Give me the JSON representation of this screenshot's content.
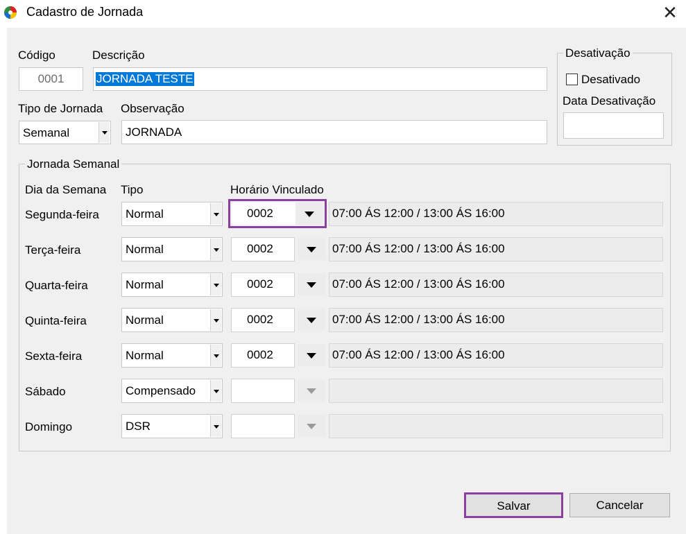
{
  "window": {
    "title": "Cadastro de Jornada",
    "close_glyph": "✕",
    "icon": "app-logo-icon"
  },
  "form": {
    "codigo_label": "Código",
    "codigo_value": "0001",
    "descricao_label": "Descrição",
    "descricao_value": "JORNADA TESTE",
    "tipo_label": "Tipo de Jornada",
    "tipo_value": "Semanal",
    "observacao_label": "Observação",
    "observacao_value": "JORNADA"
  },
  "desativacao": {
    "legend": "Desativação",
    "checkbox_label": "Desativado",
    "checked": false,
    "data_label": "Data Desativação",
    "data_value": ""
  },
  "semanal": {
    "legend": "Jornada Semanal",
    "headers": {
      "dia": "Dia da Semana",
      "tipo": "Tipo",
      "horario": "Horário Vinculado"
    },
    "rows": [
      {
        "dia": "Segunda-feira",
        "tipo": "Normal",
        "horario": "0002",
        "descricao": "07:00 ÁS 12:00 / 13:00 ÁS 16:00"
      },
      {
        "dia": "Terça-feira",
        "tipo": "Normal",
        "horario": "0002",
        "descricao": "07:00 ÁS 12:00 / 13:00 ÁS 16:00"
      },
      {
        "dia": "Quarta-feira",
        "tipo": "Normal",
        "horario": "0002",
        "descricao": "07:00 ÁS 12:00 / 13:00 ÁS 16:00"
      },
      {
        "dia": "Quinta-feira",
        "tipo": "Normal",
        "horario": "0002",
        "descricao": "07:00 ÁS 12:00 / 13:00 ÁS 16:00"
      },
      {
        "dia": "Sexta-feira",
        "tipo": "Normal",
        "horario": "0002",
        "descricao": "07:00 ÁS 12:00 / 13:00 ÁS 16:00"
      },
      {
        "dia": "Sábado",
        "tipo": "Compensado",
        "horario": "",
        "descricao": ""
      },
      {
        "dia": "Domingo",
        "tipo": "DSR",
        "horario": "",
        "descricao": ""
      }
    ]
  },
  "buttons": {
    "save": "Salvar",
    "cancel": "Cancelar"
  },
  "colors": {
    "highlight": "#8b3fa0",
    "selection": "#0078d7"
  }
}
